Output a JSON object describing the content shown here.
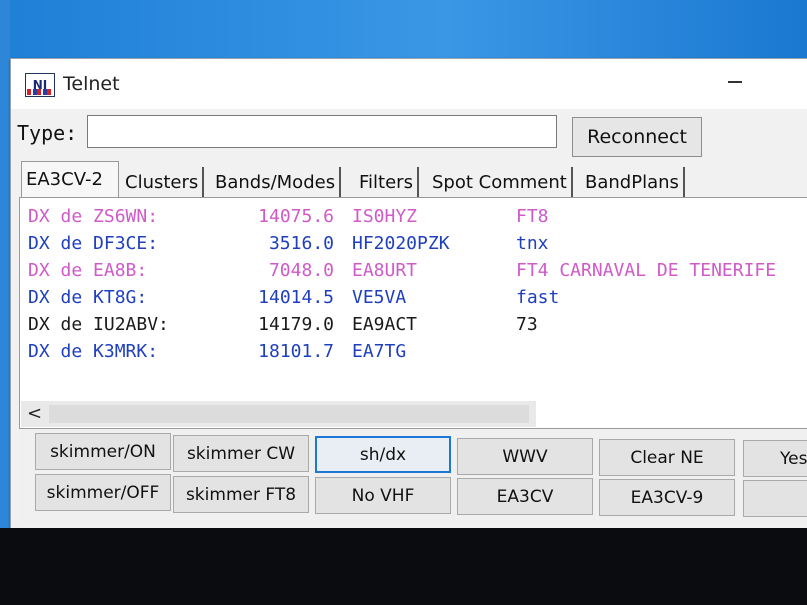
{
  "window": {
    "title": "Telnet",
    "icon_text": "NI"
  },
  "typebar": {
    "label": "Type:",
    "input_value": "",
    "reconnect_label": "Reconnect"
  },
  "tabs": [
    {
      "label": "EA3CV-2",
      "active": true
    },
    {
      "label": "Clusters",
      "active": false
    },
    {
      "label": "Bands/Modes",
      "active": false
    },
    {
      "label": "Filters",
      "active": false
    },
    {
      "label": "Spot Comment",
      "active": false
    },
    {
      "label": "BandPlans",
      "active": false
    }
  ],
  "spots": [
    {
      "spotter": "DX de ZS6WN:",
      "freq": "14075.6",
      "call": "IS0HYZ",
      "comment": "FT8",
      "color": "#d05ac8"
    },
    {
      "spotter": "DX de DF3CE:",
      "freq": "3516.0",
      "call": "HF2020PZK",
      "comment": "tnx",
      "color": "#1f3fbf"
    },
    {
      "spotter": "DX de EA8B:",
      "freq": "7048.0",
      "call": "EA8URT",
      "comment": "FT4 CARNAVAL DE TENERIFE",
      "color": "#d05ac8"
    },
    {
      "spotter": "DX de KT8G:",
      "freq": "14014.5",
      "call": "VE5VA",
      "comment": "fast",
      "color": "#1f3fbf"
    },
    {
      "spotter": "DX de IU2ABV:",
      "freq": "14179.0",
      "call": "EA9ACT",
      "comment": "73",
      "color": "#1a1a1a"
    },
    {
      "spotter": "DX de K3MRK:",
      "freq": "18101.7",
      "call": "EA7TG",
      "comment": "",
      "color": "#1f3fbf"
    }
  ],
  "scroll": {
    "left_arrow": "<"
  },
  "macro_buttons": {
    "row1": [
      "skimmer/ON",
      "skimmer CW",
      "sh/dx",
      "WWV",
      "Clear NE",
      "Yes"
    ],
    "row2": [
      "skimmer/OFF",
      "skimmer FT8",
      "No VHF",
      "EA3CV",
      "EA3CV-9",
      ""
    ]
  },
  "colors": {
    "accent": "#1c78d4",
    "desktop": "#2a8ae0"
  }
}
